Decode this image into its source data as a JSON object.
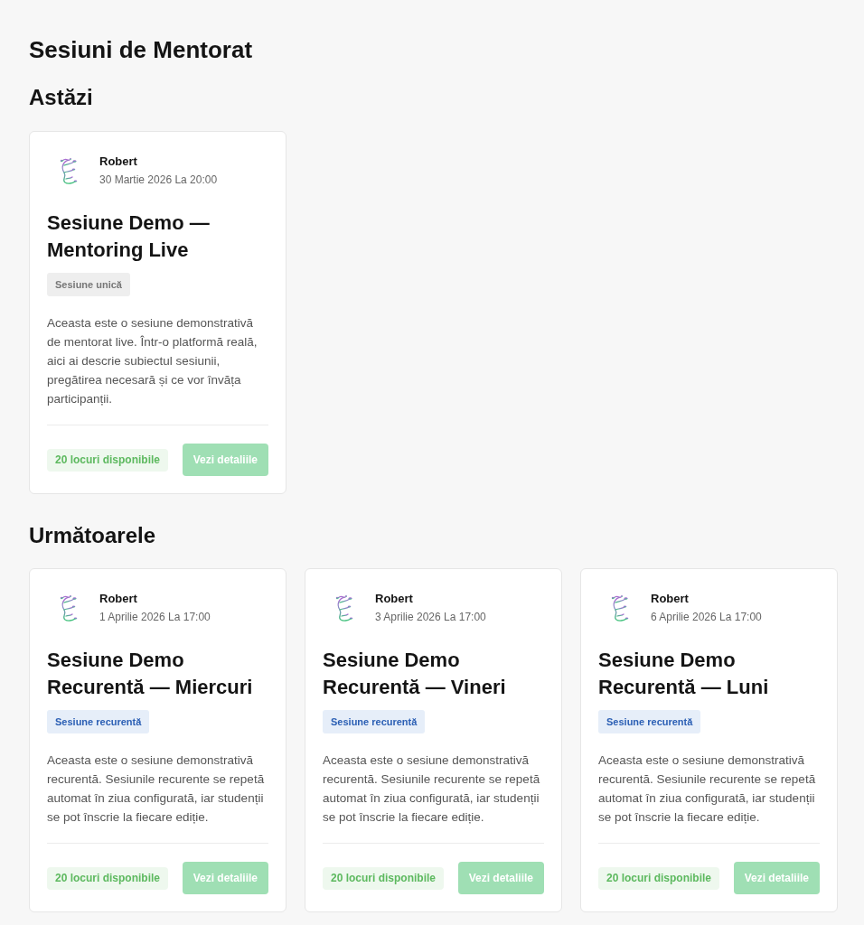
{
  "page": {
    "title": "Sesiuni de Mentorat"
  },
  "sections": [
    {
      "heading": "Astăzi",
      "sessions": [
        {
          "mentor": "Robert",
          "datetime": "30 Martie 2026 La 20:00",
          "title": "Sesiune Demo — Mentoring Live",
          "badge": {
            "label": "Sesiune unică",
            "kind": "single"
          },
          "description": "Aceasta este o sesiune demonstrativă de mentorat live. Într-o platformă reală, aici ai descrie subiectul sesiunii, pregătirea necesară și ce vor învăța participanții.",
          "seats": "20 locuri disponibile",
          "button": "Vezi detaliile"
        }
      ]
    },
    {
      "heading": "Următoarele",
      "sessions": [
        {
          "mentor": "Robert",
          "datetime": "1 Aprilie 2026 La 17:00",
          "title": "Sesiune Demo Recurentă — Miercuri",
          "badge": {
            "label": "Sesiune recurentă",
            "kind": "recurring"
          },
          "description": "Aceasta este o sesiune demonstrativă recurentă. Sesiunile recurente se repetă automat în ziua configurată, iar studenții se pot înscrie la fiecare ediție.",
          "seats": "20 locuri disponibile",
          "button": "Vezi detaliile"
        },
        {
          "mentor": "Robert",
          "datetime": "3 Aprilie 2026 La 17:00",
          "title": "Sesiune Demo Recurentă — Vineri",
          "badge": {
            "label": "Sesiune recurentă",
            "kind": "recurring"
          },
          "description": "Aceasta este o sesiune demonstrativă recurentă. Sesiunile recurente se repetă automat în ziua configurată, iar studenții se pot înscrie la fiecare ediție.",
          "seats": "20 locuri disponibile",
          "button": "Vezi detaliile"
        },
        {
          "mentor": "Robert",
          "datetime": "6 Aprilie 2026 La 17:00",
          "title": "Sesiune Demo Recurentă — Luni",
          "badge": {
            "label": "Sesiune recurentă",
            "kind": "recurring"
          },
          "description": "Aceasta este o sesiune demonstrativă recurentă. Sesiunile recurente se repetă automat în ziua configurată, iar studenții se pot înscrie la fiecare ediție.",
          "seats": "20 locuri disponibile",
          "button": "Vezi detaliile"
        }
      ]
    }
  ]
}
